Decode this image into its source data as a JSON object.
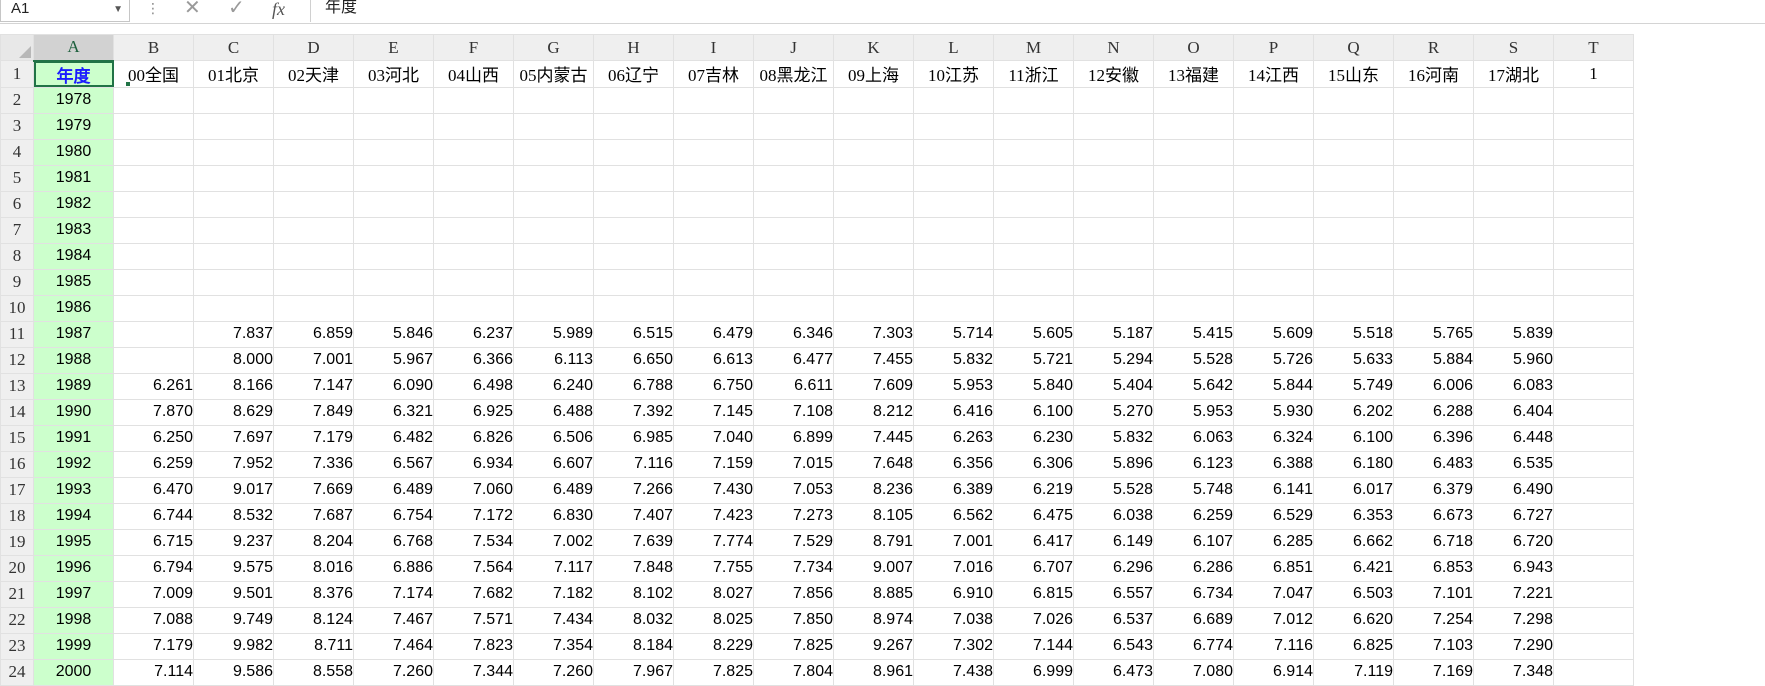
{
  "name_box": "A1",
  "formula_value": "年度",
  "formula_icons": [
    "cancel-icon",
    "confirm-icon",
    "fx-icon"
  ],
  "column_letters": [
    "A",
    "B",
    "C",
    "D",
    "E",
    "F",
    "G",
    "H",
    "I",
    "J",
    "K",
    "L",
    "M",
    "N",
    "O",
    "P",
    "Q",
    "R",
    "S",
    "T"
  ],
  "header_row": [
    "年度",
    "00全国",
    "01北京",
    "02天津",
    "03河北",
    "04山西",
    "05内蒙古",
    "06辽宁",
    "07吉林",
    "08黑龙江",
    "09上海",
    "10江苏",
    "11浙江",
    "12安徽",
    "13福建",
    "14江西",
    "15山东",
    "16河南",
    "17湖北",
    "1"
  ],
  "rows": [
    {
      "n": "2",
      "year": "1978",
      "vals": [
        "",
        "",
        "",
        "",
        "",
        "",
        "",
        "",
        "",
        "",
        "",
        "",
        "",
        "",
        "",
        "",
        "",
        ""
      ]
    },
    {
      "n": "3",
      "year": "1979",
      "vals": [
        "",
        "",
        "",
        "",
        "",
        "",
        "",
        "",
        "",
        "",
        "",
        "",
        "",
        "",
        "",
        "",
        "",
        ""
      ]
    },
    {
      "n": "4",
      "year": "1980",
      "vals": [
        "",
        "",
        "",
        "",
        "",
        "",
        "",
        "",
        "",
        "",
        "",
        "",
        "",
        "",
        "",
        "",
        "",
        ""
      ]
    },
    {
      "n": "5",
      "year": "1981",
      "vals": [
        "",
        "",
        "",
        "",
        "",
        "",
        "",
        "",
        "",
        "",
        "",
        "",
        "",
        "",
        "",
        "",
        "",
        ""
      ]
    },
    {
      "n": "6",
      "year": "1982",
      "vals": [
        "",
        "",
        "",
        "",
        "",
        "",
        "",
        "",
        "",
        "",
        "",
        "",
        "",
        "",
        "",
        "",
        "",
        ""
      ]
    },
    {
      "n": "7",
      "year": "1983",
      "vals": [
        "",
        "",
        "",
        "",
        "",
        "",
        "",
        "",
        "",
        "",
        "",
        "",
        "",
        "",
        "",
        "",
        "",
        ""
      ]
    },
    {
      "n": "8",
      "year": "1984",
      "vals": [
        "",
        "",
        "",
        "",
        "",
        "",
        "",
        "",
        "",
        "",
        "",
        "",
        "",
        "",
        "",
        "",
        "",
        ""
      ]
    },
    {
      "n": "9",
      "year": "1985",
      "vals": [
        "",
        "",
        "",
        "",
        "",
        "",
        "",
        "",
        "",
        "",
        "",
        "",
        "",
        "",
        "",
        "",
        "",
        ""
      ]
    },
    {
      "n": "10",
      "year": "1986",
      "vals": [
        "",
        "",
        "",
        "",
        "",
        "",
        "",
        "",
        "",
        "",
        "",
        "",
        "",
        "",
        "",
        "",
        "",
        ""
      ]
    },
    {
      "n": "11",
      "year": "1987",
      "vals": [
        "",
        "7.837",
        "6.859",
        "5.846",
        "6.237",
        "5.989",
        "6.515",
        "6.479",
        "6.346",
        "7.303",
        "5.714",
        "5.605",
        "5.187",
        "5.415",
        "5.609",
        "5.518",
        "5.765",
        "5.839"
      ]
    },
    {
      "n": "12",
      "year": "1988",
      "vals": [
        "",
        "8.000",
        "7.001",
        "5.967",
        "6.366",
        "6.113",
        "6.650",
        "6.613",
        "6.477",
        "7.455",
        "5.832",
        "5.721",
        "5.294",
        "5.528",
        "5.726",
        "5.633",
        "5.884",
        "5.960"
      ]
    },
    {
      "n": "13",
      "year": "1989",
      "vals": [
        "6.261",
        "8.166",
        "7.147",
        "6.090",
        "6.498",
        "6.240",
        "6.788",
        "6.750",
        "6.611",
        "7.609",
        "5.953",
        "5.840",
        "5.404",
        "5.642",
        "5.844",
        "5.749",
        "6.006",
        "6.083"
      ]
    },
    {
      "n": "14",
      "year": "1990",
      "vals": [
        "7.870",
        "8.629",
        "7.849",
        "6.321",
        "6.925",
        "6.488",
        "7.392",
        "7.145",
        "7.108",
        "8.212",
        "6.416",
        "6.100",
        "5.270",
        "5.953",
        "5.930",
        "6.202",
        "6.288",
        "6.404"
      ]
    },
    {
      "n": "15",
      "year": "1991",
      "vals": [
        "6.250",
        "7.697",
        "7.179",
        "6.482",
        "6.826",
        "6.506",
        "6.985",
        "7.040",
        "6.899",
        "7.445",
        "6.263",
        "6.230",
        "5.832",
        "6.063",
        "6.324",
        "6.100",
        "6.396",
        "6.448"
      ]
    },
    {
      "n": "16",
      "year": "1992",
      "vals": [
        "6.259",
        "7.952",
        "7.336",
        "6.567",
        "6.934",
        "6.607",
        "7.116",
        "7.159",
        "7.015",
        "7.648",
        "6.356",
        "6.306",
        "5.896",
        "6.123",
        "6.388",
        "6.180",
        "6.483",
        "6.535"
      ]
    },
    {
      "n": "17",
      "year": "1993",
      "vals": [
        "6.470",
        "9.017",
        "7.669",
        "6.489",
        "7.060",
        "6.489",
        "7.266",
        "7.430",
        "7.053",
        "8.236",
        "6.389",
        "6.219",
        "5.528",
        "5.748",
        "6.141",
        "6.017",
        "6.379",
        "6.490"
      ]
    },
    {
      "n": "18",
      "year": "1994",
      "vals": [
        "6.744",
        "8.532",
        "7.687",
        "6.754",
        "7.172",
        "6.830",
        "7.407",
        "7.423",
        "7.273",
        "8.105",
        "6.562",
        "6.475",
        "6.038",
        "6.259",
        "6.529",
        "6.353",
        "6.673",
        "6.727"
      ]
    },
    {
      "n": "19",
      "year": "1995",
      "vals": [
        "6.715",
        "9.237",
        "8.204",
        "6.768",
        "7.534",
        "7.002",
        "7.639",
        "7.774",
        "7.529",
        "8.791",
        "7.001",
        "6.417",
        "6.149",
        "6.107",
        "6.285",
        "6.662",
        "6.718",
        "6.720"
      ]
    },
    {
      "n": "20",
      "year": "1996",
      "vals": [
        "6.794",
        "9.575",
        "8.016",
        "6.886",
        "7.564",
        "7.117",
        "7.848",
        "7.755",
        "7.734",
        "9.007",
        "7.016",
        "6.707",
        "6.296",
        "6.286",
        "6.851",
        "6.421",
        "6.853",
        "6.943"
      ]
    },
    {
      "n": "21",
      "year": "1997",
      "vals": [
        "7.009",
        "9.501",
        "8.376",
        "7.174",
        "7.682",
        "7.182",
        "8.102",
        "8.027",
        "7.856",
        "8.885",
        "6.910",
        "6.815",
        "6.557",
        "6.734",
        "7.047",
        "6.503",
        "7.101",
        "7.221"
      ]
    },
    {
      "n": "22",
      "year": "1998",
      "vals": [
        "7.088",
        "9.749",
        "8.124",
        "7.467",
        "7.571",
        "7.434",
        "8.032",
        "8.025",
        "7.850",
        "8.974",
        "7.038",
        "7.026",
        "6.537",
        "6.689",
        "7.012",
        "6.620",
        "7.254",
        "7.298"
      ]
    },
    {
      "n": "23",
      "year": "1999",
      "vals": [
        "7.179",
        "9.982",
        "8.711",
        "7.464",
        "7.823",
        "7.354",
        "8.184",
        "8.229",
        "7.825",
        "9.267",
        "7.302",
        "7.144",
        "6.543",
        "6.774",
        "7.116",
        "6.825",
        "7.103",
        "7.290"
      ]
    },
    {
      "n": "24",
      "year": "2000",
      "vals": [
        "7.114",
        "9.586",
        "8.558",
        "7.260",
        "7.344",
        "7.260",
        "7.967",
        "7.825",
        "7.804",
        "8.961",
        "7.438",
        "6.999",
        "6.473",
        "7.080",
        "6.914",
        "7.119",
        "7.169",
        "7.348"
      ]
    }
  ]
}
